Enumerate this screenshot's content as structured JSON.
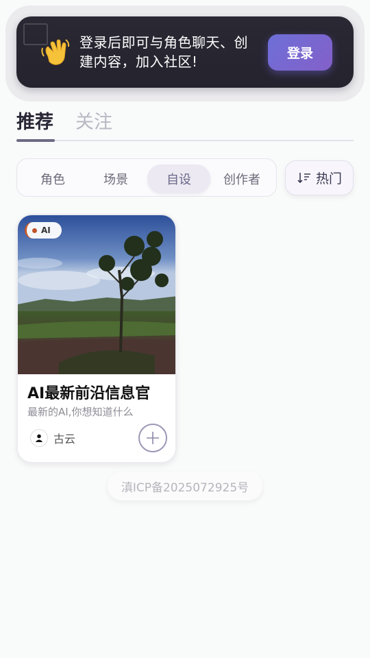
{
  "banner": {
    "text": "登录后即可与角色聊天、创建内容，加入社区!",
    "login_label": "登录"
  },
  "tabs": [
    {
      "label": "推荐",
      "active": true
    },
    {
      "label": "关注",
      "active": false
    }
  ],
  "categories": [
    {
      "label": "角色",
      "active": false
    },
    {
      "label": "场景",
      "active": false
    },
    {
      "label": "自设",
      "active": true
    },
    {
      "label": "创作者",
      "active": false
    }
  ],
  "sort": {
    "label": "热门",
    "icon": "sort-icon"
  },
  "card": {
    "badge": "AI",
    "title": "AI最新前沿信息官",
    "description": "最新的AI,你想知道什么",
    "author": "古云",
    "author_icon": "user-icon",
    "follow_icon": "plus-icon"
  },
  "footer": {
    "icp": "滇ICP备2025072925号"
  },
  "colors": {
    "accent": "#7a68d0",
    "banner_bg": "#26242e",
    "badge_dot": "#c0542a"
  }
}
